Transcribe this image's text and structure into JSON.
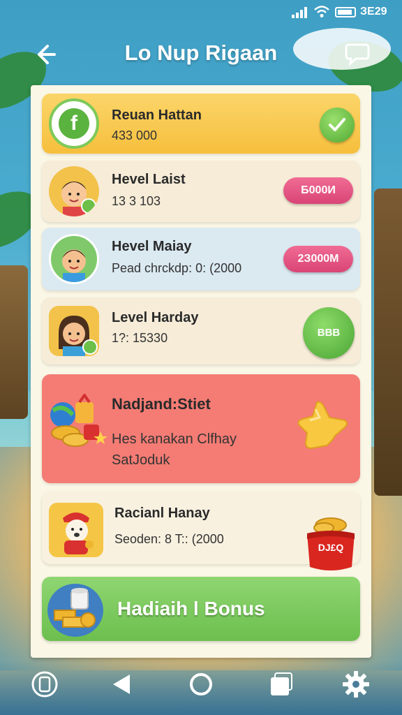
{
  "status_bar": {
    "time": "ЗЕ29"
  },
  "header": {
    "title": "Lo Nup Rigaan"
  },
  "cards": [
    {
      "title": "Reuan Hattan",
      "subtitle": "433 000",
      "avatar_letter": "f",
      "action_icon": "check-icon"
    },
    {
      "title": "Hevel Laist",
      "subtitle": "13 3 103",
      "badge": "Б000И"
    },
    {
      "title": "Hevel Maiay",
      "subtitle": "Pead chrckdp: 0: (2000",
      "badge": "2З000М"
    },
    {
      "title": "Level Harday",
      "subtitle": "1?: 15330",
      "badge": "ВВВ"
    },
    {
      "title": "Nadjand:Stiet",
      "subtitle_line1": "Hes kanakan Clfhay",
      "subtitle_line2": "SatJoduk"
    },
    {
      "title": "Racianl Hanay",
      "subtitle": "Seoden: 8 T:: (2000",
      "badge": "DJ£Q"
    }
  ],
  "bonus": {
    "label": "Hadiaih l Bonus"
  },
  "colors": {
    "accent_green": "#6cbf4e",
    "accent_pink": "#e04f80",
    "card_gold": "#f6bf3c",
    "card_red": "#f47c74"
  },
  "icons": {
    "back": "arrow-left-icon",
    "chat": "chat-bubble-icon",
    "nav": [
      "profile-icon",
      "back-triangle-icon",
      "home-circle-icon",
      "recent-square-icon",
      "gear-icon"
    ]
  }
}
